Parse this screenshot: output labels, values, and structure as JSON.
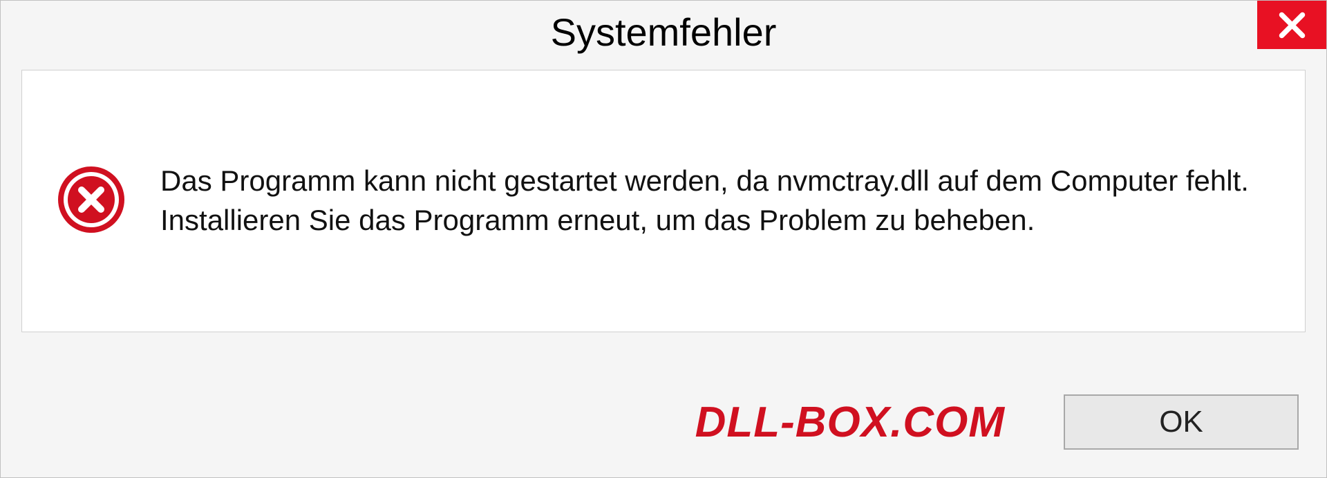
{
  "title": "Systemfehler",
  "message": "Das Programm kann nicht gestartet werden, da nvmctray.dll auf dem Computer fehlt. Installieren Sie das Programm erneut, um das Problem zu beheben.",
  "watermark": "DLL-BOX.COM",
  "ok_label": "OK"
}
